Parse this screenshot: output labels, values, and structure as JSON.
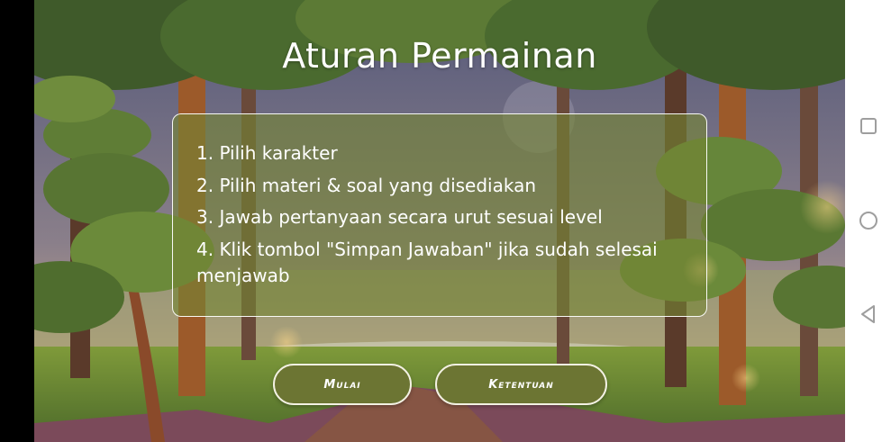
{
  "title": "Aturan Permainan",
  "rules": [
    "1. Pilih karakter",
    "2. Pilih materi & soal yang disediakan",
    "3. Jawab pertanyaan secara urut sesuai level",
    "4. Klik tombol \"Simpan Jawaban\" jika sudah selesai menjawab"
  ],
  "buttons": {
    "start_label": "Mulai",
    "rules_label": "Ketentuan"
  },
  "navigation_bar": {
    "icons": [
      "recent-apps-icon",
      "home-icon",
      "back-icon"
    ]
  },
  "colors": {
    "button_fill": "#6c7533",
    "panel_fill": "#748434",
    "title_text": "#ffffff",
    "nav_bar_bg": "#ffffff",
    "nav_icon": "#9e9e9e"
  }
}
